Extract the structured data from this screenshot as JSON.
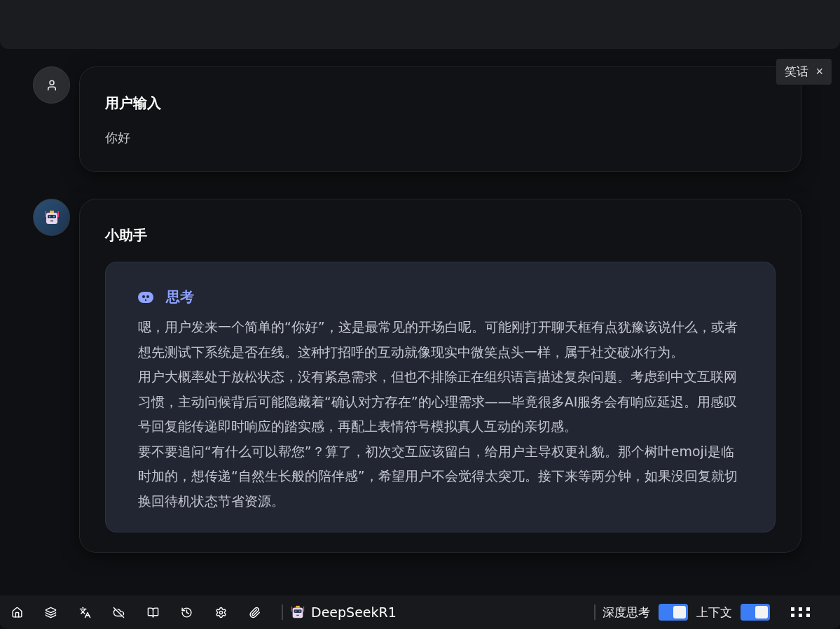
{
  "tag": {
    "label": "笑话",
    "close": "×"
  },
  "messages": [
    {
      "kind": "user",
      "author": "用户输入",
      "text": "你好"
    },
    {
      "kind": "assistant",
      "author": "小助手",
      "thinking": {
        "title": "思考",
        "paragraphs": [
          "嗯，用户发来一个简单的“你好”，这是最常见的开场白呢。可能刚打开聊天框有点犹豫该说什么，或者想先测试下系统是否在线。这种打招呼的互动就像现实中微笑点头一样，属于社交破冰行为。",
          "用户大概率处于放松状态，没有紧急需求，但也不排除正在组织语言描述复杂问题。考虑到中文互联网习惯，主动问候背后可能隐藏着“确认对方存在”的心理需求——毕竟很多AI服务会有响应延迟。用感叹号回复能传递即时响应的踏实感，再配上表情符号模拟真人互动的亲切感。",
          "要不要追问“有什么可以帮您”？算了，初次交互应该留白，给用户主导权更礼貌。那个树叶emoji是临时加的，想传递“自然生长般的陪伴感”，希望用户不会觉得太突兀。接下来等两分钟，如果没回复就切换回待机状态节省资源。"
        ]
      }
    }
  ],
  "toolbar": {
    "model": "DeepSeekR1",
    "toggles": [
      {
        "label": "深度思考",
        "on": true
      },
      {
        "label": "上下文",
        "on": true
      }
    ]
  }
}
